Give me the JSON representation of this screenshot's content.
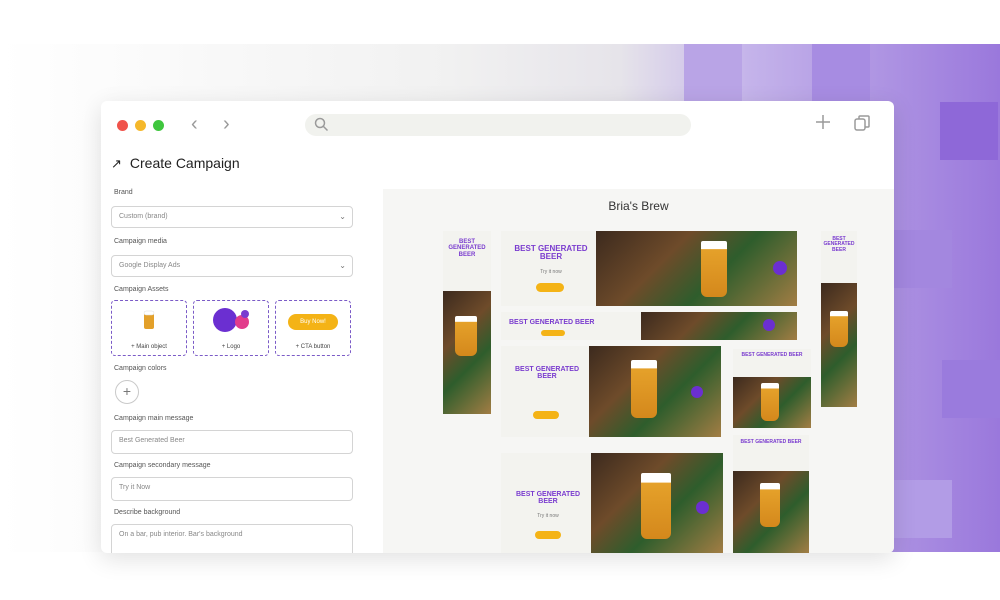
{
  "page_title": "Create Campaign",
  "fields": {
    "brand_label": "Brand",
    "brand_value": "Custom (brand)",
    "media_label": "Campaign media",
    "media_value": "Google Display Ads",
    "assets_label": "Campaign Assets",
    "colors_label": "Campaign colors",
    "add_color": "+",
    "main_message_label": "Campaign main message",
    "main_message_value": "Best Generated Beer",
    "secondary_message_label": "Campaign secondary message",
    "secondary_message_value": "Try it Now",
    "background_label": "Describe background",
    "background_value": "On a bar, pub interior. Bar's background"
  },
  "assets": [
    {
      "caption": "+ Main object"
    },
    {
      "caption": "+ Logo"
    },
    {
      "caption": "+ CTA button",
      "button_text": "Buy Now!"
    }
  ],
  "preview": {
    "title": "Bria's Brew",
    "ad_headline_stack": "BEST GENERATED BEER",
    "ad_headline_short": "BEST",
    "ad_headline_line": "BEST GENERATED BEER",
    "ad_sub": "Try it now"
  },
  "colors": {
    "accent_purple": "#7a3ccf",
    "cta_yellow": "#f4b316"
  },
  "icons": [
    "back-icon",
    "forward-icon",
    "search-icon",
    "new-tab-icon",
    "copy-window-icon",
    "arrow-icon",
    "chevron-down-icon"
  ]
}
